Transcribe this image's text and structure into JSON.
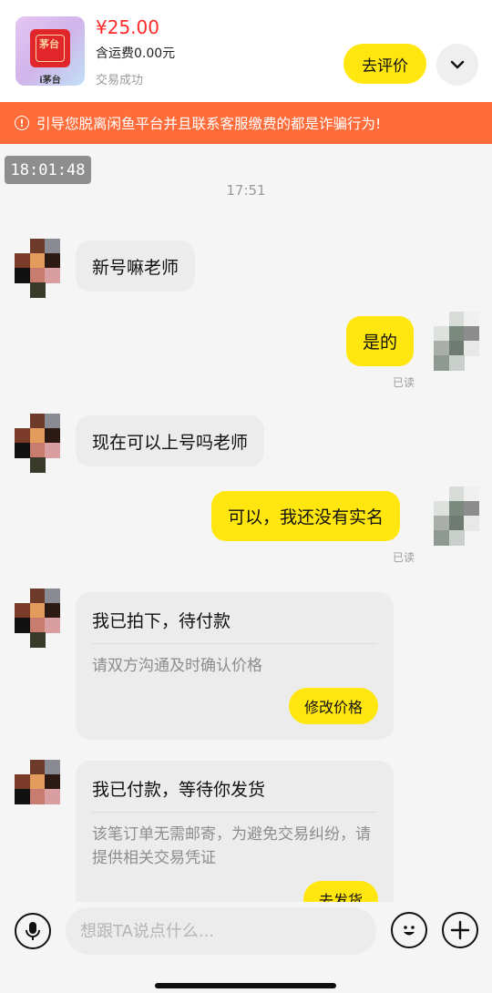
{
  "order": {
    "app_label": "i茅台",
    "brand_mark": "茅台",
    "price": "¥25.00",
    "shipping": "含运费0.00元",
    "status": "交易成功",
    "review_button": "去评价",
    "expand_icon": "chevron-down-icon"
  },
  "warning": {
    "icon": "!",
    "text": "引导您脱离闲鱼平台并且联系客服缴费的都是诈骗行为!"
  },
  "timestamp_stamp": "18:01:48",
  "time_divider": "17:51",
  "messages": [
    {
      "side": "left",
      "text": "新号嘛老师"
    },
    {
      "side": "right",
      "text": "是的",
      "read": "已读"
    },
    {
      "side": "left",
      "text": "现在可以上号吗老师"
    },
    {
      "side": "right",
      "text": "可以，我还没有实名",
      "read": "已读"
    }
  ],
  "cards": [
    {
      "title": "我已拍下，待付款",
      "desc": "请双方沟通及时确认价格",
      "action": "修改价格"
    },
    {
      "title": "我已付款，等待你发货",
      "desc": "该笔订单无需邮寄，为避免交易纠纷，请提供相关交易凭证",
      "action": "去发货"
    }
  ],
  "input": {
    "placeholder": "想跟TA说点什么...",
    "value": ""
  },
  "colors": {
    "accent_yellow": "#ffe60f",
    "price_red": "#ff2a2a",
    "warning_orange": "#ff6c3a",
    "bubble_grey": "#ececec"
  }
}
